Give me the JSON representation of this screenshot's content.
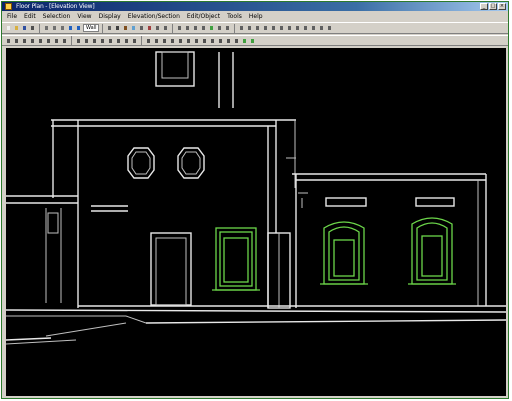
{
  "window": {
    "title": "Floor Plan - [Elevation View]",
    "controls": [
      "_",
      "□",
      "×"
    ]
  },
  "menubar": {
    "items": [
      "File",
      "Edit",
      "Selection",
      "View",
      "Display",
      "Elevation/Section",
      "Edit/Object",
      "Tools",
      "Help"
    ]
  },
  "toolbar": {
    "combo_label": "Wall"
  },
  "drawing": {
    "line_color": "#e8e8e8",
    "selection_color": "#6cd64a",
    "background": "#000000"
  }
}
